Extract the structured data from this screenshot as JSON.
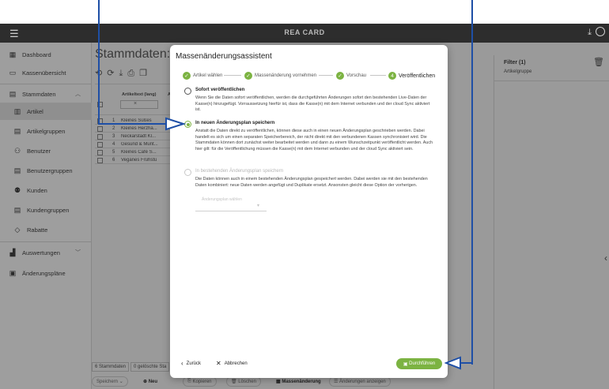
{
  "app": {
    "title": "REA CARD",
    "menu_icon": "hamburger-icon",
    "download_icon": "download-icon",
    "account_icon": "account-icon"
  },
  "sidebar": {
    "items": [
      {
        "label": "Dashboard",
        "icon": "dashboard-icon"
      },
      {
        "label": "Kassenübersicht",
        "icon": "register-icon"
      },
      {
        "label": "Stammdaten",
        "icon": "masterdata-icon",
        "expandable": true
      },
      {
        "label": "Artikel",
        "icon": "article-icon",
        "active": true
      },
      {
        "label": "Artikelgruppen",
        "icon": "group-icon"
      },
      {
        "label": "Benutzer",
        "icon": "user-icon"
      },
      {
        "label": "Benutzergruppen",
        "icon": "usergroup-icon"
      },
      {
        "label": "Kunden",
        "icon": "customer-icon"
      },
      {
        "label": "Kundengruppen",
        "icon": "customergroup-icon"
      },
      {
        "label": "Rabatte",
        "icon": "tag-icon"
      },
      {
        "label": "Auswertungen",
        "icon": "chart-icon",
        "expandable": true
      },
      {
        "label": "Änderungspläne",
        "icon": "plan-icon"
      }
    ]
  },
  "main": {
    "page_title": "Stammdaten: Art",
    "column_header": "Artikeltext (lang)",
    "column_header_short": "Ar",
    "clear_symbol": "×",
    "rows": [
      {
        "num": "1",
        "text": "Kleines Süßes"
      },
      {
        "num": "2",
        "text": "Kleines Herzha..."
      },
      {
        "num": "3",
        "text": "Neckarstadt Kl..."
      },
      {
        "num": "4",
        "text": "Gesund & Munt..."
      },
      {
        "num": "5",
        "text": "Kleines Café S..."
      },
      {
        "num": "6",
        "text": "Veganes Frühstü"
      }
    ],
    "status": {
      "count": "6 Stammdaten",
      "selected": "0 gelöschte Sta"
    }
  },
  "filter": {
    "title": "Filter (1)",
    "subtitle": "Artikelgruppe"
  },
  "bottombar": {
    "speichern": "Speichern",
    "neu": "Neu",
    "kopieren": "Kopieren",
    "loeschen": "Löschen",
    "massenaenderung": "Massenänderung",
    "aenderungen": "Änderungen anzeigen"
  },
  "dialog": {
    "title": "Massenänderungsassistent",
    "steps": [
      {
        "label": "Artikel wählen",
        "marker": "✓"
      },
      {
        "label": "Massenänderung vornehmen",
        "marker": "✓"
      },
      {
        "label": "Vorschau",
        "marker": "✓"
      },
      {
        "label": "Veröffentlichen",
        "marker": "4"
      }
    ],
    "options": [
      {
        "title": "Sofort veröffentlichen",
        "desc": "Wenn Sie die Daten sofort veröffentlichen, werden die durchgeführten Änderungen sofort den bestehenden Live-Daten der Kasse(n) hinzugefügt. Vorraussetzung hierfür ist, dass die Kasse(n) mit dem Internet verbunden und der cloud Sync aktiviert ist."
      },
      {
        "title": "In neuen Änderungsplan speichern",
        "desc": "Anstatt die Daten direkt zu veröffentlichen, können diese auch in einen neuen Änderungsplan geschrieben werden. Dabei handelt es sich um einen separaten Speicherbereich, der nicht direkt mit den verbundenen Kassen synchronisiert wird. Die Stammdaten können dort zunächst weiter bearbeitet werden und dann zu einem Wunschzeitpunkt veröffentlicht werden. Auch hier gilt: für die Veröffentlichung müssen die Kasse(n) mit dem Internet verbunden und der cloud Sync aktiviert sein."
      },
      {
        "title": "In bestehenden Änderungsplan speichern",
        "desc": "Die Daten können auch in einem bestehenden Änderungsplan gespeichert werden. Dabei werden sie mit den bestehenden Daten kombiniert: neue Daten werden angefügt und Duplikate ersetzt. Ansonsten gleicht diese Option der vorherigen."
      }
    ],
    "plan_select_label": "Änderungsplan wählen",
    "back": "Zurück",
    "cancel": "Abbrechen",
    "execute": "Durchführen"
  },
  "colors": {
    "accent_green": "#7cb342",
    "callout_blue": "#1e4fa6",
    "appbar": "#2d2d2d"
  }
}
